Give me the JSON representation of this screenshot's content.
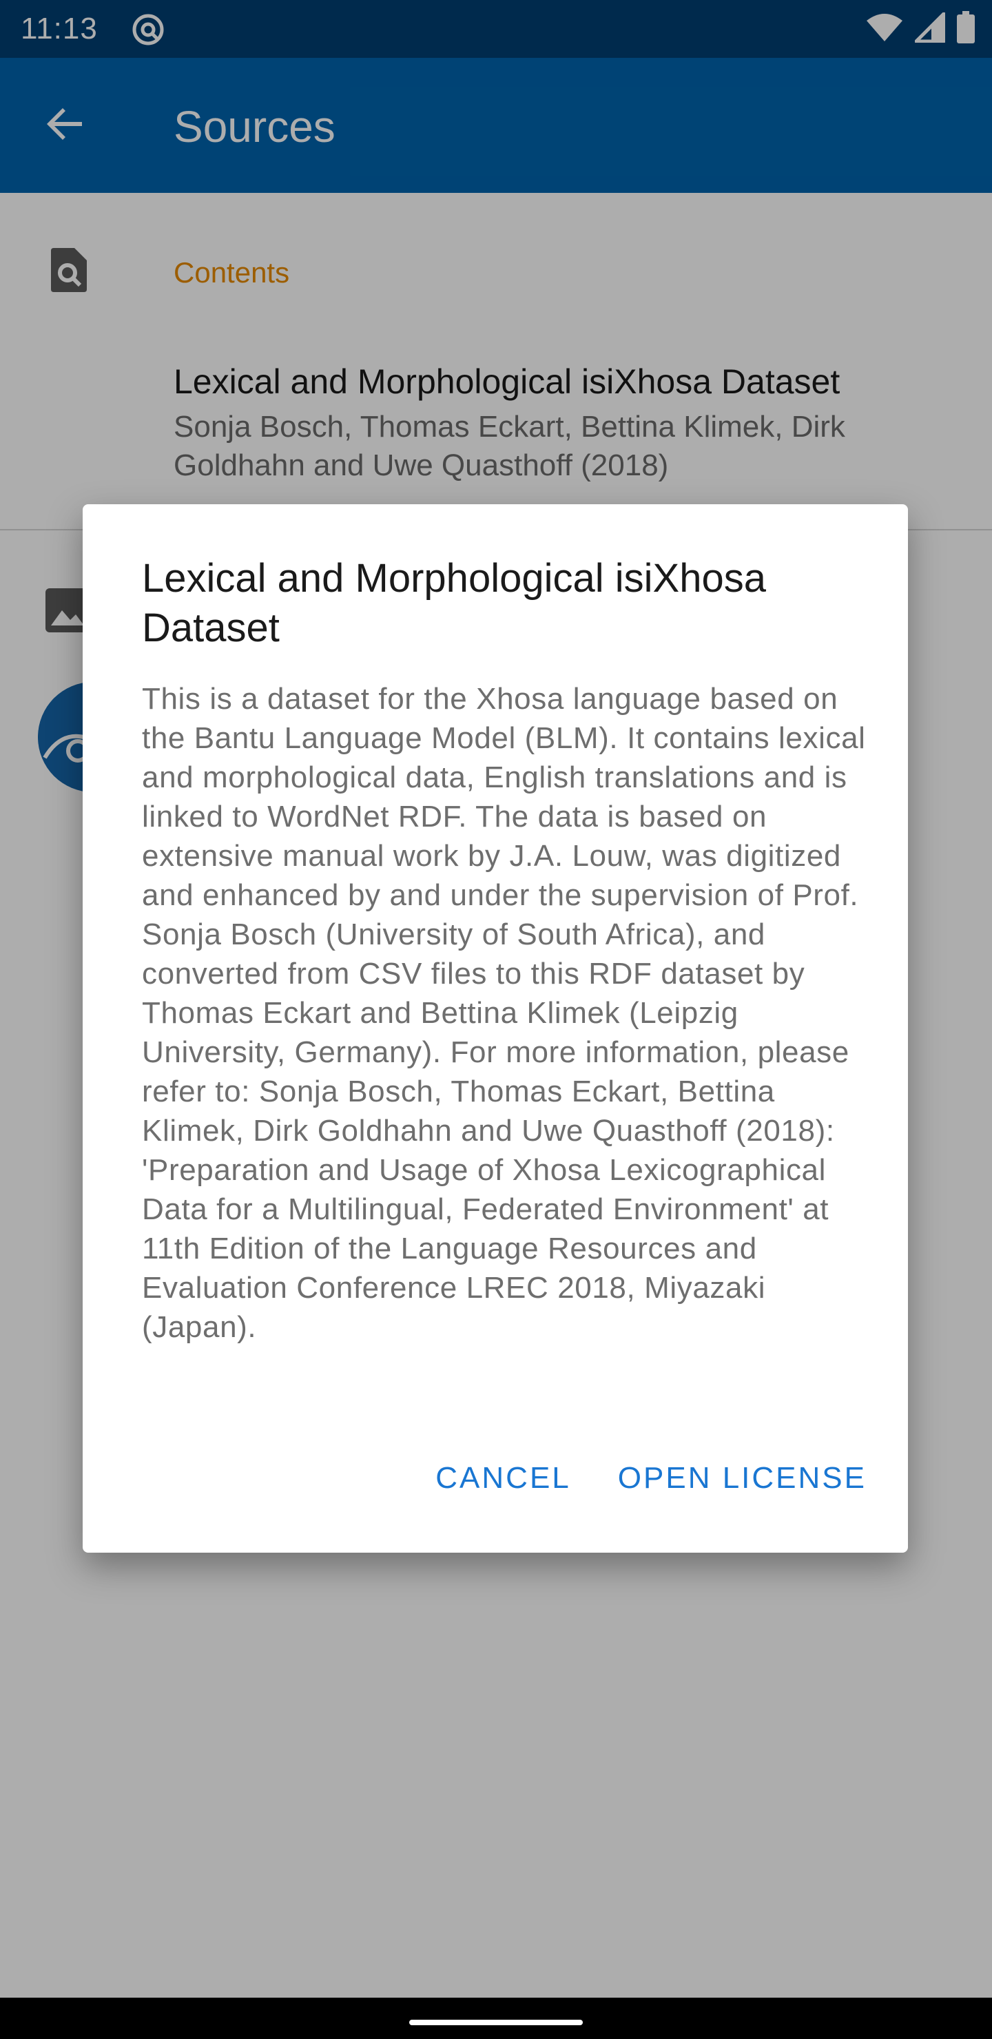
{
  "status_bar": {
    "time": "11:13",
    "icons": [
      "at-icon",
      "wifi-icon",
      "signal-icon",
      "battery-icon"
    ]
  },
  "app_bar": {
    "back_icon": "arrow-back-icon",
    "title": "Sources"
  },
  "content": {
    "section_icon": "find-in-page-icon",
    "section_title": "Contents",
    "item": {
      "title": "Lexical and Morphological isiXhosa Dataset",
      "subtitle": "Sonja Bosch, Thomas Eckart, Bettina Klimek, Dirk Goldhahn and Uwe Quasthoff (2018)"
    },
    "image_icon": "image-icon"
  },
  "dialog": {
    "title": "Lexical and Morphological isiXhosa Dataset",
    "body": "This is a dataset for the Xhosa language based on the Bantu Language Model (BLM). It contains lexical and morphological data, English translations and is linked to WordNet RDF. The data is based on extensive manual work by J.A. Louw, was digitized and enhanced by and under the supervision of Prof. Sonja Bosch (University of South Africa), and converted from CSV files to this RDF dataset by Thomas Eckart and Bettina Klimek (Leipzig University, Germany). For more information, please refer to: Sonja Bosch, Thomas Eckart, Bettina Klimek, Dirk Goldhahn and Uwe Quasthoff (2018): 'Preparation and Usage of Xhosa Lexicographical Data for a Multilingual, Federated Environment' at 11th Edition of the Language Resources and Evaluation Conference LREC 2018, Miyazaki (Japan).",
    "cancel_label": "CANCEL",
    "open_license_label": "OPEN LICENSE"
  },
  "colors": {
    "status_bar": "#003e72",
    "app_bar": "#0064ad",
    "accent": "#e68a00",
    "button": "#1976d2"
  }
}
